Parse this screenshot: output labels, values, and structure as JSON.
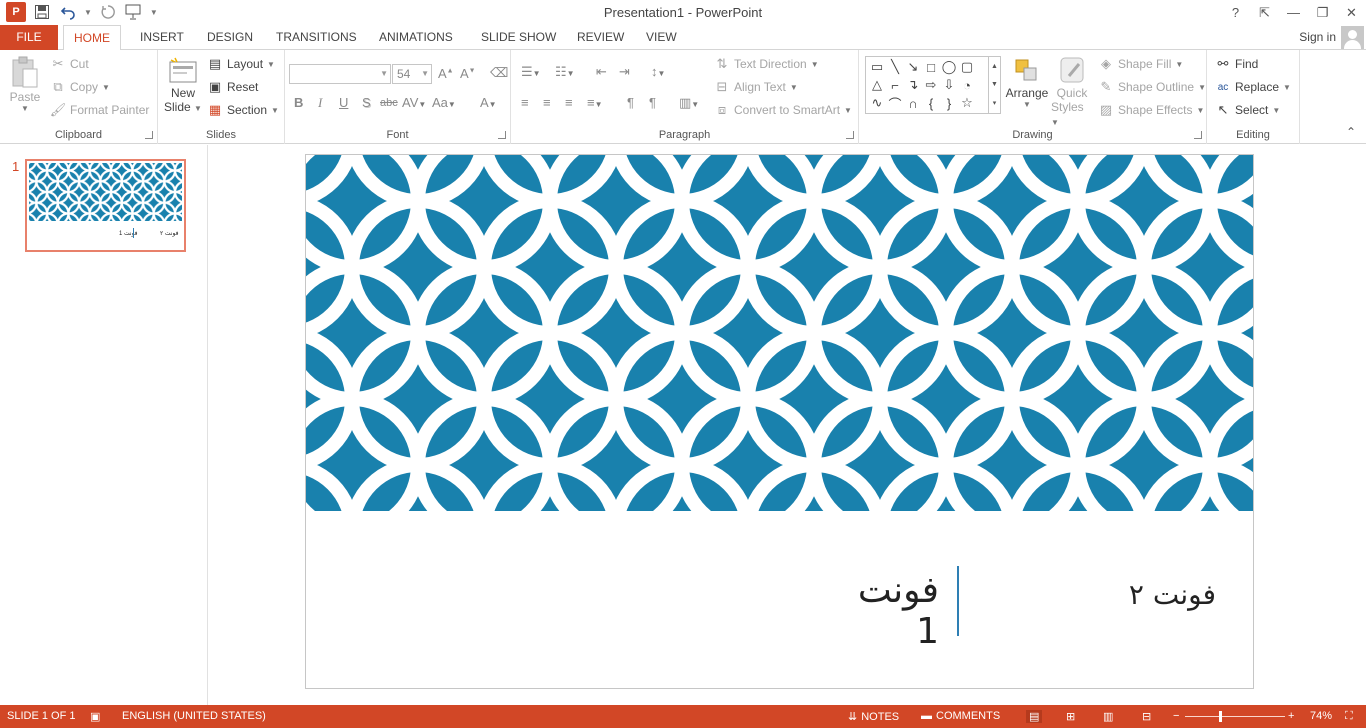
{
  "titlebar": {
    "title": "Presentation1 - PowerPoint",
    "app_logo": "P",
    "controls": {
      "help": "?",
      "restore_ribbon": "⇱",
      "minimize": "—",
      "maximize": "❐",
      "close": "✕"
    }
  },
  "tabs": {
    "file": "FILE",
    "items": [
      "HOME",
      "INSERT",
      "DESIGN",
      "TRANSITIONS",
      "ANIMATIONS",
      "SLIDE SHOW",
      "REVIEW",
      "VIEW"
    ],
    "active": "HOME",
    "sign_in": "Sign in"
  },
  "ribbon": {
    "clipboard": {
      "label": "Clipboard",
      "paste": "Paste",
      "cut": "Cut",
      "copy": "Copy",
      "format_painter": "Format Painter"
    },
    "slides": {
      "label": "Slides",
      "new_slide_line1": "New",
      "new_slide_line2": "Slide",
      "layout": "Layout",
      "reset": "Reset",
      "section": "Section"
    },
    "font": {
      "label": "Font",
      "font_name": "",
      "font_size": "54",
      "bold": "B",
      "italic": "I",
      "underline": "U",
      "shadow": "S",
      "strikethrough": "abc",
      "spacing": "AV",
      "change_case": "Aa",
      "font_color": "A"
    },
    "paragraph": {
      "label": "Paragraph",
      "text_direction": "Text Direction",
      "align_text": "Align Text",
      "convert_smartart": "Convert to SmartArt"
    },
    "drawing": {
      "label": "Drawing",
      "arrange": "Arrange",
      "quick_styles_line1": "Quick",
      "quick_styles_line2": "Styles",
      "shape_fill": "Shape Fill",
      "shape_outline": "Shape Outline",
      "shape_effects": "Shape Effects"
    },
    "editing": {
      "label": "Editing",
      "find": "Find",
      "replace": "Replace",
      "select": "Select"
    }
  },
  "thumbnails": {
    "slide_number": "1",
    "text_left": "فونت ۲",
    "text_right": "فونت 1"
  },
  "slide": {
    "text_font1": "فونت 1",
    "text_font2": "فونت ۲",
    "pattern_color": "#1981ad",
    "divider_color": "#2e7fb4"
  },
  "statusbar": {
    "slide_info": "SLIDE 1 OF 1",
    "language": "ENGLISH (UNITED STATES)",
    "notes": "NOTES",
    "comments": "COMMENTS",
    "zoom": "74%",
    "zoom_minus": "−",
    "zoom_plus": "+"
  },
  "colors": {
    "accent": "#d24726",
    "thumb_border": "#e8816b"
  }
}
